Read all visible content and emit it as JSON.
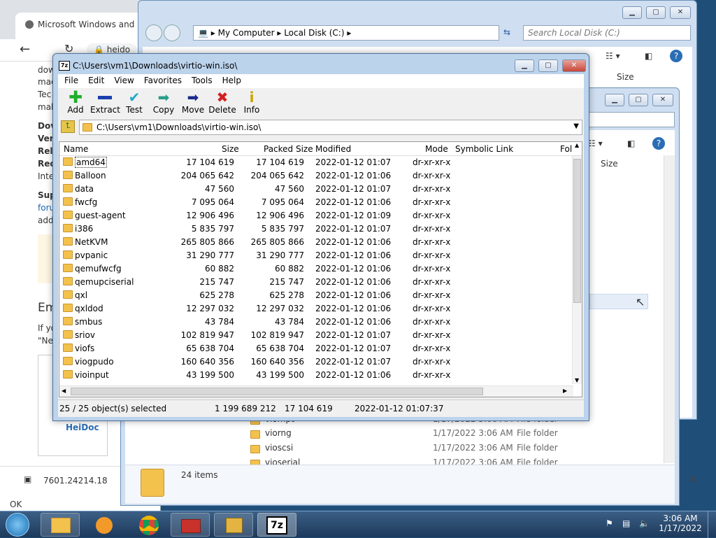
{
  "browser": {
    "tab_title": "Microsoft Windows and O",
    "url": "heido",
    "fragments": [
      "dow",
      "mac",
      "Tec",
      "mak",
      "Dov",
      "Ver",
      "Rel",
      "Rec",
      "Inte",
      "Sup",
      "foru",
      "add",
      "Em",
      "If yo",
      "\"Ne"
    ],
    "logo_text": "HeiDoc",
    "download_item": "7601.24214.18",
    "status_text": "OK"
  },
  "explorer1": {
    "breadcrumb": [
      "My Computer",
      "Local Disk (C:)"
    ],
    "search_placeholder": "Search Local Disk (C:)",
    "col_size": "Size"
  },
  "explorer2": {
    "col_size": "Size",
    "files": [
      {
        "name": "viompt",
        "date": "1/17/2022 3:06 AM",
        "type": "File folder"
      },
      {
        "name": "viorng",
        "date": "1/17/2022 3:06 AM",
        "type": "File folder"
      },
      {
        "name": "vioscsi",
        "date": "1/17/2022 3:06 AM",
        "type": "File folder"
      },
      {
        "name": "vioserial",
        "date": "1/17/2022 3:06 AM",
        "type": "File folder"
      }
    ],
    "item_count": "24 items"
  },
  "zip": {
    "title": "C:\\Users\\vm1\\Downloads\\virtio-win.iso\\",
    "menu": [
      "File",
      "Edit",
      "View",
      "Favorites",
      "Tools",
      "Help"
    ],
    "tools": [
      {
        "label": "Add",
        "icon": "add-icon"
      },
      {
        "label": "Extract",
        "icon": "extract-icon"
      },
      {
        "label": "Test",
        "icon": "test-icon"
      },
      {
        "label": "Copy",
        "icon": "copy-icon"
      },
      {
        "label": "Move",
        "icon": "move-icon"
      },
      {
        "label": "Delete",
        "icon": "delete-icon"
      },
      {
        "label": "Info",
        "icon": "info-icon"
      }
    ],
    "path": "C:\\Users\\vm1\\Downloads\\virtio-win.iso\\",
    "columns": [
      "Name",
      "Size",
      "Packed Size",
      "Modified",
      "Mode",
      "Symbolic Link",
      "Fol"
    ],
    "rows": [
      [
        "amd64",
        "17 104 619",
        "17 104 619",
        "2022-01-12 01:07",
        "dr-xr-xr-x"
      ],
      [
        "Balloon",
        "204 065 642",
        "204 065 642",
        "2022-01-12 01:06",
        "dr-xr-xr-x"
      ],
      [
        "data",
        "47 560",
        "47 560",
        "2022-01-12 01:07",
        "dr-xr-xr-x"
      ],
      [
        "fwcfg",
        "7 095 064",
        "7 095 064",
        "2022-01-12 01:06",
        "dr-xr-xr-x"
      ],
      [
        "guest-agent",
        "12 906 496",
        "12 906 496",
        "2022-01-12 01:09",
        "dr-xr-xr-x"
      ],
      [
        "i386",
        "5 835 797",
        "5 835 797",
        "2022-01-12 01:07",
        "dr-xr-xr-x"
      ],
      [
        "NetKVM",
        "265 805 866",
        "265 805 866",
        "2022-01-12 01:06",
        "dr-xr-xr-x"
      ],
      [
        "pvpanic",
        "31 290 777",
        "31 290 777",
        "2022-01-12 01:06",
        "dr-xr-xr-x"
      ],
      [
        "qemufwcfg",
        "60 882",
        "60 882",
        "2022-01-12 01:06",
        "dr-xr-xr-x"
      ],
      [
        "qemupciserial",
        "215 747",
        "215 747",
        "2022-01-12 01:06",
        "dr-xr-xr-x"
      ],
      [
        "qxl",
        "625 278",
        "625 278",
        "2022-01-12 01:06",
        "dr-xr-xr-x"
      ],
      [
        "qxldod",
        "12 297 032",
        "12 297 032",
        "2022-01-12 01:06",
        "dr-xr-xr-x"
      ],
      [
        "smbus",
        "43 784",
        "43 784",
        "2022-01-12 01:06",
        "dr-xr-xr-x"
      ],
      [
        "sriov",
        "102 819 947",
        "102 819 947",
        "2022-01-12 01:07",
        "dr-xr-xr-x"
      ],
      [
        "viofs",
        "65 638 704",
        "65 638 704",
        "2022-01-12 01:07",
        "dr-xr-xr-x"
      ],
      [
        "viogpudo",
        "160 640 356",
        "160 640 356",
        "2022-01-12 01:07",
        "dr-xr-xr-x"
      ],
      [
        "vioinput",
        "43 199 500",
        "43 199 500",
        "2022-01-12 01:06",
        "dr-xr-xr-x"
      ]
    ],
    "status": {
      "selection": "25 / 25 object(s) selected",
      "total_size": "1 199 689 212",
      "item_size": "17 104 619",
      "modified": "2022-01-12 01:07:37"
    }
  },
  "taskbar": {
    "time": "3:06 AM",
    "date": "1/17/2022",
    "apps": [
      "start-orb",
      "explorer",
      "media-player",
      "chrome",
      "toolbox",
      "archiver",
      "7zip"
    ]
  }
}
